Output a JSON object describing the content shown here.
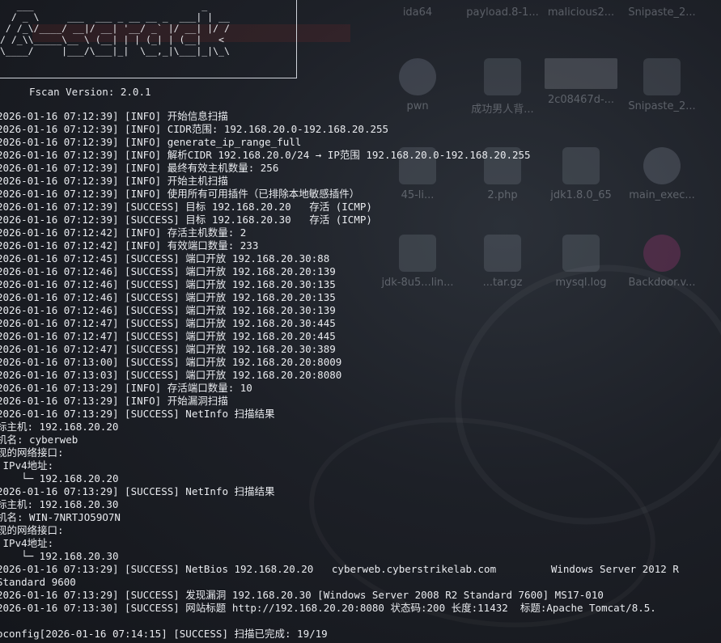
{
  "desktop": {
    "icons": [
      {
        "label": "ida64",
        "kind": "blank"
      },
      {
        "label": "payload.8-1...",
        "kind": "blank"
      },
      {
        "label": "malicious2...",
        "kind": "blank"
      },
      {
        "label": "Snipaste_2...",
        "kind": "blank"
      },
      {
        "label": "pwn",
        "kind": "gear"
      },
      {
        "label": "成功男人背...",
        "kind": "blank"
      },
      {
        "label": "2c08467d-...",
        "kind": "img"
      },
      {
        "label": "Snipaste_2...",
        "kind": "blank"
      },
      {
        "label": "45-li...",
        "kind": "blank"
      },
      {
        "label": "2.php",
        "kind": "blank"
      },
      {
        "label": "jdk1.8.0_65",
        "kind": "blank"
      },
      {
        "label": "main_exec...",
        "kind": "gear"
      },
      {
        "label": "jdk-8u5...lin...",
        "kind": "blank"
      },
      {
        "label": "...tar.gz",
        "kind": "blank"
      },
      {
        "label": "mysql.log",
        "kind": "blank"
      },
      {
        "label": "Backdoor.v...",
        "kind": "pink"
      }
    ]
  },
  "terminal": {
    "banner": "   ___                              _    \n  / _ \\     ___  ___ _ __ __ _  ___| | __ \n / /_\\/____/ __|/ __| '__/ _` |/ __| |/ / \n/ /_\\\\_____\\__ \\ (__| | | (_| | (__|   <  \n\\____/     |___/\\___|_|  \\__,_|\\___|_|\\_\\ ",
    "version": "Fscan Version: 2.0.1",
    "lines": [
      "2026-01-16 07:12:39] [INFO] 开始信息扫描",
      "2026-01-16 07:12:39] [INFO] CIDR范围: 192.168.20.0-192.168.20.255",
      "2026-01-16 07:12:39] [INFO] generate_ip_range_full",
      "2026-01-16 07:12:39] [INFO] 解析CIDR 192.168.20.0/24 → IP范围 192.168.20.0-192.168.20.255",
      "2026-01-16 07:12:39] [INFO] 最终有效主机数量: 256",
      "2026-01-16 07:12:39] [INFO] 开始主机扫描",
      "2026-01-16 07:12:39] [INFO] 使用所有可用插件（已排除本地敏感插件）",
      "2026-01-16 07:12:39] [SUCCESS] 目标 192.168.20.20   存活 (ICMP)",
      "2026-01-16 07:12:39] [SUCCESS] 目标 192.168.20.30   存活 (ICMP)",
      "2026-01-16 07:12:42] [INFO] 存活主机数量: 2",
      "2026-01-16 07:12:42] [INFO] 有效端口数量: 233",
      "2026-01-16 07:12:45] [SUCCESS] 端口开放 192.168.20.30:88",
      "2026-01-16 07:12:46] [SUCCESS] 端口开放 192.168.20.20:139",
      "2026-01-16 07:12:46] [SUCCESS] 端口开放 192.168.20.30:135",
      "2026-01-16 07:12:46] [SUCCESS] 端口开放 192.168.20.20:135",
      "2026-01-16 07:12:46] [SUCCESS] 端口开放 192.168.20.30:139",
      "2026-01-16 07:12:47] [SUCCESS] 端口开放 192.168.20.30:445",
      "2026-01-16 07:12:47] [SUCCESS] 端口开放 192.168.20.20:445",
      "2026-01-16 07:12:47] [SUCCESS] 端口开放 192.168.20.30:389",
      "2026-01-16 07:13:00] [SUCCESS] 端口开放 192.168.20.20:8009",
      "2026-01-16 07:13:03] [SUCCESS] 端口开放 192.168.20.20:8080",
      "2026-01-16 07:13:29] [INFO] 存活端口数量: 10",
      "2026-01-16 07:13:29] [INFO] 开始漏洞扫描",
      "2026-01-16 07:13:29] [SUCCESS] NetInfo 扫描结果",
      "标主机: 192.168.20.20",
      "机名: cyberweb",
      "现的网络接口:",
      " IPv4地址:",
      "    └─ 192.168.20.20",
      "2026-01-16 07:13:29] [SUCCESS] NetInfo 扫描结果",
      "标主机: 192.168.20.30",
      "机名: WIN-7NRTJO59O7N",
      "现的网络接口:",
      " IPv4地址:",
      "    └─ 192.168.20.30",
      "2026-01-16 07:13:29] [SUCCESS] NetBios 192.168.20.20   cyberweb.cyberstrikelab.com         Windows Server 2012 R",
      "Standard 9600",
      "2026-01-16 07:13:29] [SUCCESS] 发现漏洞 192.168.20.30 [Windows Server 2008 R2 Standard 7600] MS17-010",
      "2026-01-16 07:13:30] [SUCCESS] 网站标题 http://192.168.20.20:8080 状态码:200 长度:11432  标题:Apache Tomcat/8.5.",
      "",
      "oconfig[2026-01-16 07:14:15] [SUCCESS] 扫描已完成: 19/19"
    ]
  }
}
